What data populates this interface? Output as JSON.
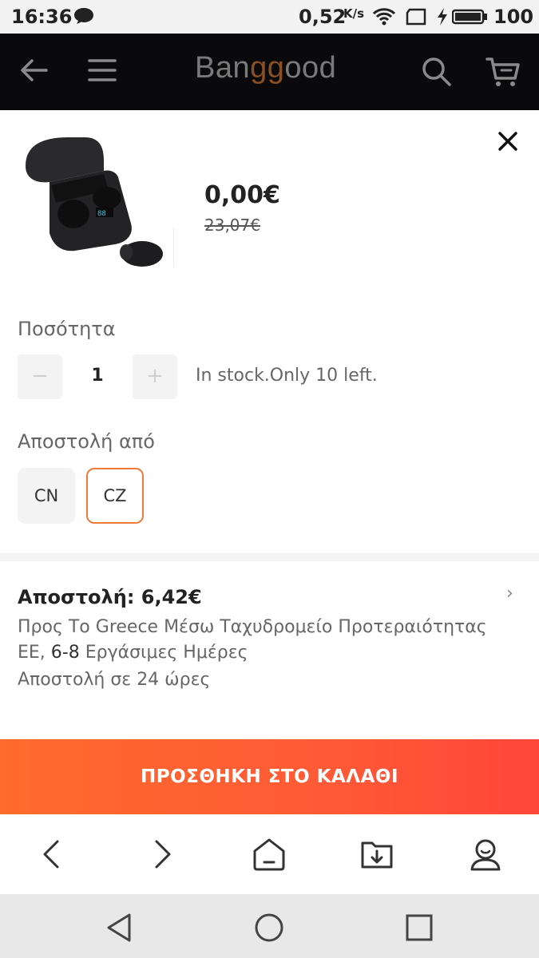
{
  "status_bar": {
    "time": "16:36",
    "speed": "0,52",
    "speed_unit": "K/s",
    "battery": "100"
  },
  "header": {
    "logo_part1": "Ban",
    "logo_part2": "gg",
    "logo_part3": "ood",
    "icons": [
      "back-arrow",
      "hamburger-menu",
      "search",
      "cart"
    ]
  },
  "product": {
    "price": "0,00€",
    "original_price": "23,07€"
  },
  "quantity": {
    "label": "Ποσότητα",
    "value": "1",
    "minus": "−",
    "plus": "+",
    "stock": "In stock.Only 10 left."
  },
  "ship_from": {
    "label": "Αποστολή από",
    "options": [
      "CN",
      "CZ"
    ],
    "selected": "CZ"
  },
  "shipping": {
    "title": "Αποστολή: 6,42€",
    "chevron": "›",
    "line1": "Προς Το Greece Μέσω Ταχυδρομείο Προτεραιότητας",
    "line2_prefix": "EE, ",
    "line2_days": "6-8",
    "line2_suffix": " Εργάσιμες Ημέρες",
    "line3": "Αποστολή σε 24 ώρες"
  },
  "cart_button": {
    "label": "ΠΡΟΣΘΗΚΗ ΣΤΟ ΚΑΛΑΘΙ"
  },
  "colors": {
    "accent": "#ff5a36",
    "selected_border": "#f07a3a"
  }
}
